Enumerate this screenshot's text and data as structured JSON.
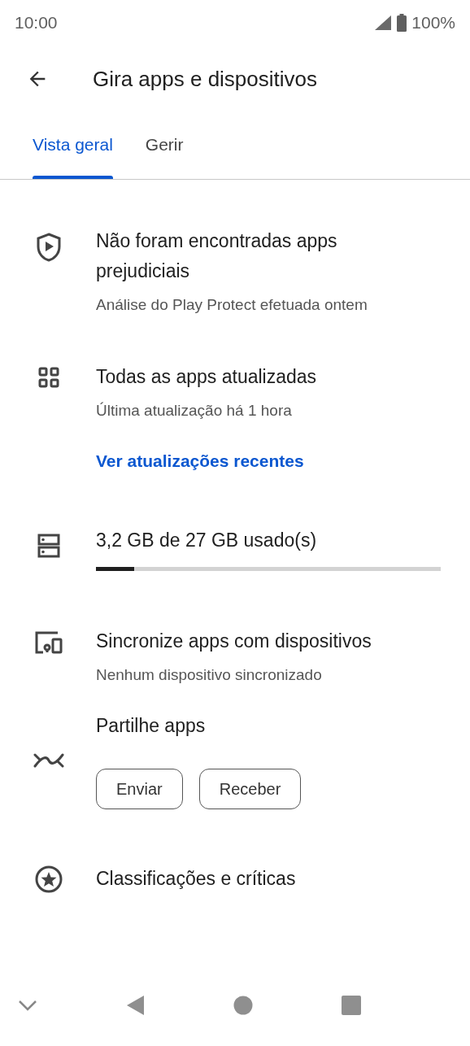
{
  "status_bar": {
    "time": "10:00",
    "battery": "100%"
  },
  "app_bar": {
    "title": "Gira apps e dispositivos"
  },
  "tabs": [
    {
      "label": "Vista geral",
      "selected": true
    },
    {
      "label": "Gerir",
      "selected": false
    }
  ],
  "sections": [
    {
      "kind": "protect",
      "title": "Não foram encontradas apps prejudiciais",
      "subtitle": "Análise do Play Protect efetuada ontem"
    },
    {
      "kind": "updates",
      "title": "Todas as apps atualizadas",
      "subtitle": "Última atualização há 1 hora",
      "link": "Ver atualizações recentes"
    },
    {
      "kind": "storage",
      "title": "3,2 GB de 27 GB usado(s)",
      "level": 0.11
    },
    {
      "kind": "sync",
      "title": "Sincronize apps com dispositivos",
      "subtitle": "Nenhum dispositivo sincronizado"
    },
    {
      "kind": "share",
      "title": "Partilhe apps",
      "buttons": [
        "Enviar",
        "Receber"
      ]
    },
    {
      "kind": "ratings",
      "title": "Classificações e críticas"
    }
  ]
}
